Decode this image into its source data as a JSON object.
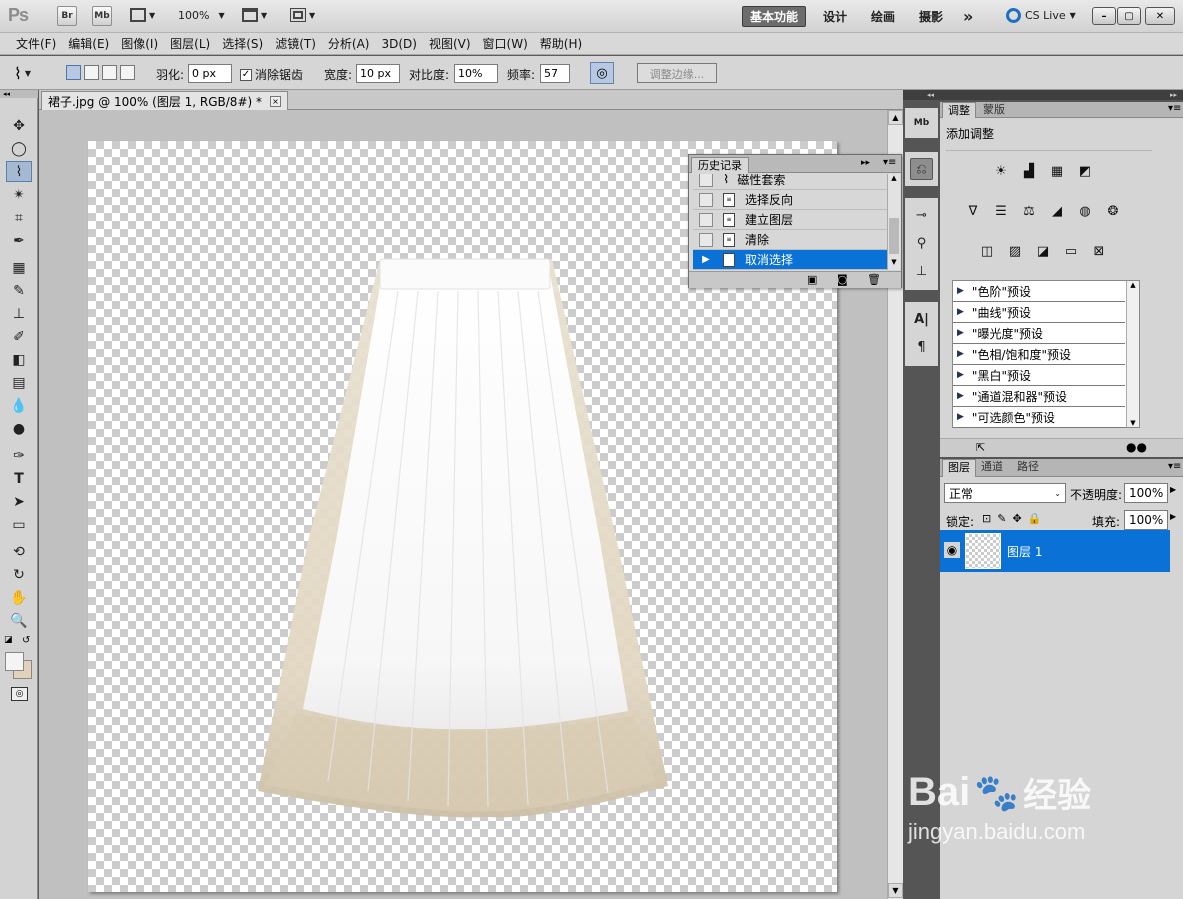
{
  "app": {
    "logo": "Ps",
    "bridge_label": "Br",
    "mini_bridge_label": "Mb",
    "zoom": "100%",
    "workspaces": [
      "基本功能",
      "设计",
      "绘画",
      "摄影"
    ],
    "more": "»",
    "cs_live": "CS Live",
    "win_min": "–",
    "win_max": "▢",
    "win_close": "✕"
  },
  "menu": [
    "文件(F)",
    "编辑(E)",
    "图像(I)",
    "图层(L)",
    "选择(S)",
    "滤镜(T)",
    "分析(A)",
    "3D(D)",
    "视图(V)",
    "窗口(W)",
    "帮助(H)"
  ],
  "options": {
    "feather_label": "羽化:",
    "feather_value": "0 px",
    "antialias_label": "消除锯齿",
    "width_label": "宽度:",
    "width_value": "10 px",
    "contrast_label": "对比度:",
    "contrast_value": "10%",
    "frequency_label": "频率:",
    "frequency_value": "57",
    "refine_edge_label": "调整边缘..."
  },
  "document": {
    "tab_title": "裙子.jpg @ 100% (图层 1, RGB/8#) *",
    "close": "×"
  },
  "history": {
    "title": "历史记录",
    "items": [
      {
        "label": "磁性套索"
      },
      {
        "label": "选择反向"
      },
      {
        "label": "建立图层"
      },
      {
        "label": "清除"
      },
      {
        "label": "取消选择"
      }
    ]
  },
  "adjustments": {
    "tabs": [
      "调整",
      "蒙版"
    ],
    "add_label": "添加调整",
    "presets": [
      "\"色阶\"预设",
      "\"曲线\"预设",
      "\"曝光度\"预设",
      "\"色相/饱和度\"预设",
      "\"黑白\"预设",
      "\"通道混和器\"预设",
      "\"可选颜色\"预设"
    ]
  },
  "layers": {
    "tabs": [
      "图层",
      "通道",
      "路径"
    ],
    "blend_mode": "正常",
    "opacity_label": "不透明度:",
    "opacity_value": "100%",
    "lock_label": "锁定:",
    "fill_label": "填充:",
    "fill_value": "100%",
    "items": [
      {
        "name": "图层 1"
      }
    ]
  },
  "watermark": {
    "brand": "Bai",
    "brand2": "经验",
    "url": "jingyan.baidu.com"
  }
}
